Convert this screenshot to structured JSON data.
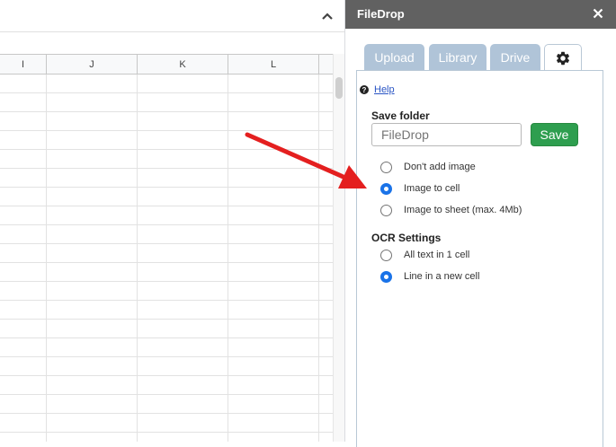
{
  "sheet": {
    "columns": [
      "I",
      "J",
      "K",
      "L"
    ],
    "row_count": 20
  },
  "panel": {
    "title": "FileDrop",
    "close_icon": "close-icon"
  },
  "tabs": [
    {
      "label": "Upload"
    },
    {
      "label": "Library"
    },
    {
      "label": "Drive"
    }
  ],
  "settings_tab": {
    "icon": "gear-icon"
  },
  "help": {
    "label": "Help",
    "icon": "question-circle-icon"
  },
  "save_folder": {
    "label": "Save folder",
    "placeholder": "FileDrop",
    "value": "",
    "save_label": "Save"
  },
  "image_options": [
    {
      "label": "Don't add image",
      "checked": false
    },
    {
      "label": "Image to cell",
      "checked": true
    },
    {
      "label": "Image to sheet (max. 4Mb)",
      "checked": false
    }
  ],
  "ocr": {
    "label": "OCR Settings",
    "options": [
      {
        "label": "All text in 1 cell",
        "checked": false
      },
      {
        "label": "Line in a new cell",
        "checked": true
      }
    ]
  },
  "colors": {
    "panel_header": "#616161",
    "tab_inactive": "#b0c4d8",
    "save_button": "#2e9e4f",
    "radio_selected": "#1a73e8",
    "annotation_arrow": "#e41f1f"
  }
}
